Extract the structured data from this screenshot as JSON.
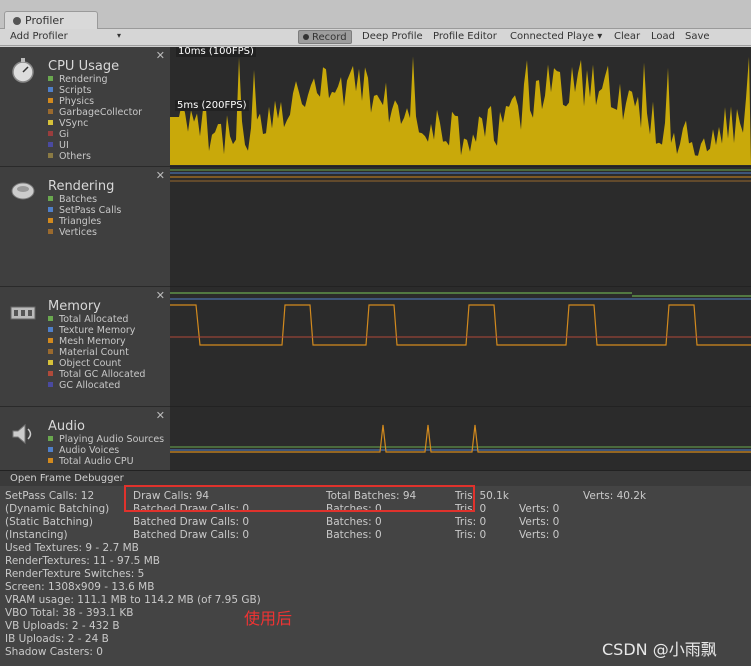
{
  "window": {
    "tab_title": "Profiler"
  },
  "toolbar": {
    "add_profiler": "Add Profiler",
    "record": "Record",
    "deep_profile": "Deep Profile",
    "profile_editor": "Profile Editor",
    "connected_player": "Connected Playe",
    "clear": "Clear",
    "load": "Load",
    "save": "Save"
  },
  "modules": [
    {
      "title": "CPU Usage",
      "legend": [
        {
          "label": "Rendering",
          "color": "#6aa84f"
        },
        {
          "label": "Scripts",
          "color": "#4f7fc8"
        },
        {
          "label": "Physics",
          "color": "#d28a1e"
        },
        {
          "label": "GarbageCollector",
          "color": "#9a6a2e"
        },
        {
          "label": "VSync",
          "color": "#d7c23a"
        },
        {
          "label": "Gi",
          "color": "#9a3d3d"
        },
        {
          "label": "UI",
          "color": "#4a4aa0"
        },
        {
          "label": "Others",
          "color": "#8a7a44"
        }
      ]
    },
    {
      "title": "Rendering",
      "legend": [
        {
          "label": "Batches",
          "color": "#6aa84f"
        },
        {
          "label": "SetPass Calls",
          "color": "#4f7fc8"
        },
        {
          "label": "Triangles",
          "color": "#d28a1e"
        },
        {
          "label": "Vertices",
          "color": "#9a6a2e"
        }
      ]
    },
    {
      "title": "Memory",
      "legend": [
        {
          "label": "Total Allocated",
          "color": "#6aa84f"
        },
        {
          "label": "Texture Memory",
          "color": "#4f7fc8"
        },
        {
          "label": "Mesh Memory",
          "color": "#d28a1e"
        },
        {
          "label": "Material Count",
          "color": "#9a6a2e"
        },
        {
          "label": "Object Count",
          "color": "#d7c23a"
        },
        {
          "label": "Total GC Allocated",
          "color": "#b04a3a"
        },
        {
          "label": "GC Allocated",
          "color": "#4a4aa0"
        }
      ]
    },
    {
      "title": "Audio",
      "legend": [
        {
          "label": "Playing Audio Sources",
          "color": "#6aa84f"
        },
        {
          "label": "Audio Voices",
          "color": "#4f7fc8"
        },
        {
          "label": "Total Audio CPU",
          "color": "#d28a1e"
        }
      ]
    }
  ],
  "cpu_graph": {
    "label_10ms": "10ms (100FPS)",
    "label_5ms": "5ms (200FPS)"
  },
  "open_frame_debugger": "Open Frame Debugger",
  "stats": {
    "setpass": "SetPass Calls: 12",
    "draw_calls": "Draw Calls: 94",
    "total_batches": "Total Batches: 94",
    "tris_total": "Tris: 50.1k",
    "verts_total": "Verts: 40.2k",
    "dyn": "(Dynamic Batching)",
    "dyn_bdc": "Batched Draw Calls: 0",
    "dyn_batches": "Batches: 0",
    "dyn_tris": "Tris: 0",
    "dyn_verts": "Verts: 0",
    "stat": "(Static Batching)",
    "stat_bdc": "Batched Draw Calls: 0",
    "stat_batches": "Batches: 0",
    "stat_tris": "Tris: 0",
    "stat_verts": "Verts: 0",
    "inst": "(Instancing)",
    "inst_bdc": "Batched Draw Calls: 0",
    "inst_batches": "Batches: 0",
    "inst_tris": "Tris: 0",
    "inst_verts": "Verts: 0",
    "used_textures": "Used Textures: 9 - 2.7 MB",
    "render_textures": "RenderTextures: 11 - 97.5 MB",
    "rt_switches": "RenderTexture Switches: 5",
    "screen": "Screen: 1308x909 - 13.6 MB",
    "vram": "VRAM usage: 111.1 MB to 114.2 MB (of 7.95 GB)",
    "vbo": "VBO Total: 38 - 393.1 KB",
    "vb_uploads": "VB Uploads: 2 - 432 B",
    "ib_uploads": "IB Uploads: 2 - 24 B",
    "shadow_casters": "Shadow Casters: 0"
  },
  "annotation": "使用后",
  "watermark": "CSDN @小雨飘",
  "colors": {
    "accent_red": "#e0322c",
    "cpu_fill": "#c9a90a",
    "panel_bg": "#2b2b2b"
  }
}
